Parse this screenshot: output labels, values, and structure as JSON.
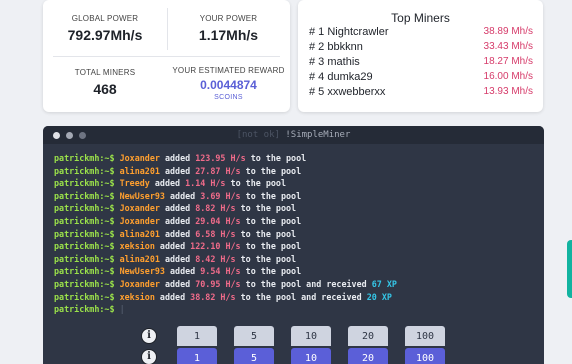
{
  "stats": {
    "global_power_label": "GLOBAL POWER",
    "global_power_value": "792.97Mh/s",
    "your_power_label": "YOUR POWER",
    "your_power_value": "1.17Mh/s",
    "total_miners_label": "TOTAL MINERS",
    "total_miners_value": "468",
    "reward_label": "YOUR ESTIMATED REWARD",
    "reward_value": "0.0044874",
    "reward_unit": "SCOINS"
  },
  "top_miners": {
    "title": "Top Miners",
    "rows": [
      {
        "rank": "# 1",
        "name": "Nightcrawler",
        "hashrate": "38.89 Mh/s"
      },
      {
        "rank": "# 2",
        "name": "bbkknn",
        "hashrate": "33.43 Mh/s"
      },
      {
        "rank": "# 3",
        "name": "mathis",
        "hashrate": "18.27 Mh/s"
      },
      {
        "rank": "# 4",
        "name": "dumka29",
        "hashrate": "16.00 Mh/s"
      },
      {
        "rank": "# 5",
        "name": "xxwebberxx",
        "hashrate": "13.93 Mh/s"
      }
    ]
  },
  "terminal": {
    "title_dim": "[not ok]",
    "title": "!SimpleMiner",
    "prompt": "patrickmh:~$",
    "log": [
      {
        "user": "Joxander",
        "rate": "123.95 H/s",
        "xp": ""
      },
      {
        "user": "alina201",
        "rate": "27.87 H/s",
        "xp": ""
      },
      {
        "user": "Treedy",
        "rate": "1.14 H/s",
        "xp": ""
      },
      {
        "user": "NewUser93",
        "rate": "3.69 H/s",
        "xp": ""
      },
      {
        "user": "Joxander",
        "rate": "8.82 H/s",
        "xp": ""
      },
      {
        "user": "Joxander",
        "rate": "29.04 H/s",
        "xp": ""
      },
      {
        "user": "alina201",
        "rate": "6.58 H/s",
        "xp": ""
      },
      {
        "user": "xeksion",
        "rate": "122.10 H/s",
        "xp": ""
      },
      {
        "user": "alina201",
        "rate": "8.42 H/s",
        "xp": ""
      },
      {
        "user": "NewUser93",
        "rate": "9.54 H/s",
        "xp": ""
      },
      {
        "user": "Joxander",
        "rate": "70.95 H/s",
        "xp": "67 XP"
      },
      {
        "user": "xeksion",
        "rate": "38.82 H/s",
        "xp": "20 XP"
      }
    ],
    "added_text": "added",
    "to_pool_text": "to the pool",
    "received_text": "and received",
    "cursor": "|"
  },
  "controls": {
    "info_glyph": "i",
    "amounts_top": [
      "1",
      "5",
      "10",
      "20",
      "100"
    ],
    "amounts_bottom": [
      "1",
      "5",
      "10",
      "20",
      "100"
    ]
  }
}
